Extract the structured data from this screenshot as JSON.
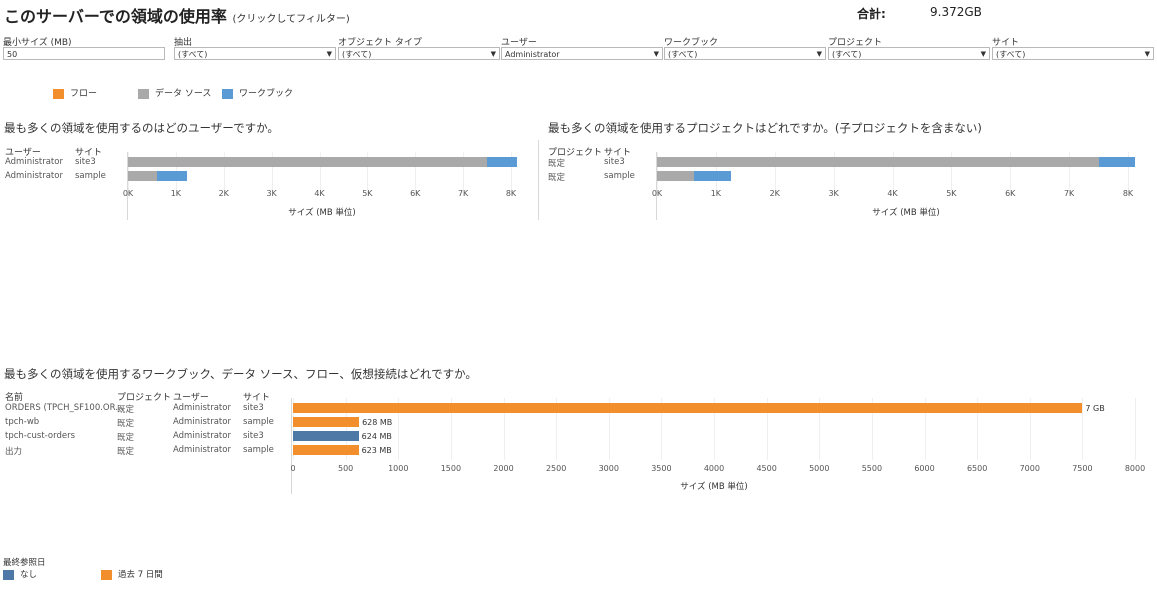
{
  "title": "このサーバーでの領域の使用率",
  "subtitle": "(クリックしてフィルター)",
  "total": {
    "label": "合計:",
    "value": "9.372GB"
  },
  "filters": [
    {
      "label": "最小サイズ (MB)",
      "value": "50",
      "dropdown": false
    },
    {
      "label": "抽出",
      "value": "(すべて)",
      "dropdown": true
    },
    {
      "label": "オブジェクト タイプ",
      "value": "(すべて)",
      "dropdown": true
    },
    {
      "label": "ユーザー",
      "value": "Administrator",
      "dropdown": true
    },
    {
      "label": "ワークブック",
      "value": "(すべて)",
      "dropdown": true
    },
    {
      "label": "プロジェクト",
      "value": "(すべて)",
      "dropdown": true
    },
    {
      "label": "サイト",
      "value": "(すべて)",
      "dropdown": true
    }
  ],
  "type_legend": [
    {
      "label": "フロー",
      "color": "#f28e2b"
    },
    {
      "label": "データ ソース",
      "color": "#a9a9a9"
    },
    {
      "label": "ワークブック",
      "color": "#5b9bd5"
    }
  ],
  "users_chart": {
    "title": "最も多くの領域を使用するのはどのユーザーですか。",
    "headers": [
      "ユーザー",
      "サイト"
    ],
    "rows": [
      {
        "user": "Administrator",
        "site": "site3"
      },
      {
        "user": "Administrator",
        "site": "sample"
      }
    ],
    "ticks": [
      "0K",
      "1K",
      "2K",
      "3K",
      "4K",
      "5K",
      "6K",
      "7K",
      "8K"
    ],
    "axis_title": "サイズ (MB 単位)"
  },
  "projects_chart": {
    "title": "最も多くの領域を使用するプロジェクトはどれですか。(子プロジェクトを含まない)",
    "headers": [
      "プロジェクト",
      "サイト"
    ],
    "rows": [
      {
        "project": "既定",
        "site": "site3"
      },
      {
        "project": "既定",
        "site": "sample"
      }
    ],
    "ticks": [
      "0K",
      "1K",
      "2K",
      "3K",
      "4K",
      "5K",
      "6K",
      "7K",
      "8K"
    ],
    "axis_title": "サイズ (MB 単位)"
  },
  "items_chart": {
    "title": "最も多くの領域を使用するワークブック、データ ソース、フロー、仮想接続はどれですか。",
    "headers": [
      "名前",
      "プロジェクト",
      "ユーザー",
      "サイト"
    ],
    "rows": [
      {
        "name": "ORDERS (TPCH_SF100.OR...",
        "project": "既定",
        "user": "Administrator",
        "site": "site3",
        "label": "7 GB"
      },
      {
        "name": "tpch-wb",
        "project": "既定",
        "user": "Administrator",
        "site": "sample",
        "label": "628 MB"
      },
      {
        "name": "tpch-cust-orders",
        "project": "既定",
        "user": "Administrator",
        "site": "site3",
        "label": "624 MB"
      },
      {
        "name": "出力",
        "project": "既定",
        "user": "Administrator",
        "site": "sample",
        "label": "623 MB"
      }
    ],
    "ticks": [
      "0",
      "500",
      "1000",
      "1500",
      "2000",
      "2500",
      "3000",
      "3500",
      "4000",
      "4500",
      "5000",
      "5500",
      "6000",
      "6500",
      "7000",
      "7500",
      "8000"
    ],
    "axis_title": "サイズ (MB 単位)"
  },
  "date_legend": {
    "title": "最終参照日",
    "items": [
      {
        "label": "なし",
        "color": "#4e79a7"
      },
      {
        "label": "過去 7 日間",
        "color": "#f28e2b"
      }
    ]
  },
  "chart_data": [
    {
      "type": "bar",
      "orientation": "horizontal",
      "stacked": true,
      "title": "最も多くの領域を使用するのはどのユーザーですか。",
      "categories": [
        "Administrator / site3",
        "Administrator / sample"
      ],
      "series": [
        {
          "name": "フロー",
          "values": [
            0,
            0
          ]
        },
        {
          "name": "データ ソース",
          "values": [
            7500,
            600
          ]
        },
        {
          "name": "ワークブック",
          "values": [
            620,
            640
          ]
        }
      ],
      "xlabel": "サイズ (MB 単位)",
      "xlim": [
        0,
        8000
      ]
    },
    {
      "type": "bar",
      "orientation": "horizontal",
      "stacked": true,
      "title": "最も多くの領域を使用するプロジェクトはどれですか。(子プロジェクトを含まない)",
      "categories": [
        "既定 / site3",
        "既定 / sample"
      ],
      "series": [
        {
          "name": "フロー",
          "values": [
            0,
            0
          ]
        },
        {
          "name": "データ ソース",
          "values": [
            7500,
            620
          ]
        },
        {
          "name": "ワークブック",
          "values": [
            620,
            630
          ]
        }
      ],
      "xlabel": "サイズ (MB 単位)",
      "xlim": [
        0,
        8000
      ]
    },
    {
      "type": "bar",
      "orientation": "horizontal",
      "title": "最も多くの領域を使用するワークブック、データ ソース、フロー、仮想接続はどれですか。",
      "categories": [
        "ORDERS (TPCH_SF100.OR...",
        "tpch-wb",
        "tpch-cust-orders",
        "出力"
      ],
      "values": [
        7500,
        628,
        624,
        623
      ],
      "bar_colors": [
        "#f28e2b",
        "#f28e2b",
        "#4e79a7",
        "#f28e2b"
      ],
      "data_labels": [
        "7 GB",
        "628 MB",
        "624 MB",
        "623 MB"
      ],
      "xlabel": "サイズ (MB 単位)",
      "xlim": [
        0,
        8000
      ]
    }
  ]
}
